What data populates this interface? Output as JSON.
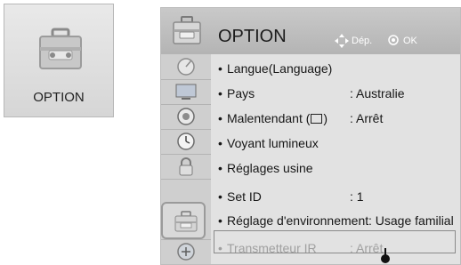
{
  "tile": {
    "label": "OPTION",
    "icon": "toolbox-icon"
  },
  "header": {
    "title": "OPTION",
    "nav_hint_icon": "dpad-icon",
    "nav_hint_label": "Dép.",
    "ok_hint_icon": "ok-button-icon",
    "ok_hint_label": "OK"
  },
  "rail": {
    "icons": [
      "satellite-dish-icon",
      "tv-screen-icon",
      "speaker-icon",
      "clock-icon",
      "lock-icon",
      "toolbox-icon",
      "usb-icon"
    ],
    "selected_index": 5
  },
  "items": [
    {
      "label": "Langue(Language)",
      "value": ""
    },
    {
      "label": "Pays",
      "value": ": Australie"
    },
    {
      "label": "Malentendant (",
      "label_suffix": ")",
      "value": ": Arrêt"
    },
    {
      "label": "Voyant lumineux",
      "value": ""
    },
    {
      "label": "Réglages usine",
      "value": ""
    },
    {
      "label": "Set ID",
      "value": ": 1"
    },
    {
      "label": "Réglage d'environnement",
      "value": ": Usage familial"
    },
    {
      "label": "Transmetteur IR",
      "value": ": Arrêt"
    }
  ],
  "colors": {
    "accent_selected_border": "#8a8a8a",
    "disabled_text": "#a0a0a0"
  }
}
